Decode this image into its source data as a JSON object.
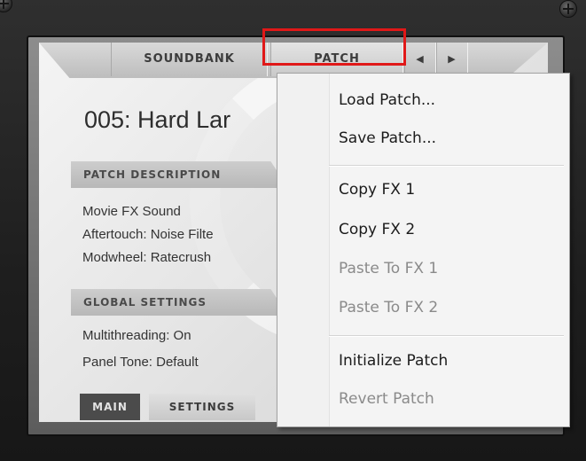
{
  "tabs": {
    "soundbank": "SOUNDBANK",
    "patch": "PATCH",
    "prev": "◀",
    "next": "▶"
  },
  "patch": {
    "name": "005: Hard Lar"
  },
  "description": {
    "header": "PATCH DESCRIPTION",
    "lines": [
      "Movie FX Sound",
      "Aftertouch: Noise Filte",
      "Modwheel: Ratecrush"
    ]
  },
  "global": {
    "header": "GLOBAL SETTINGS",
    "lines": [
      "Multithreading: On",
      "Panel Tone: Default"
    ]
  },
  "bottom_tabs": {
    "main": "MAIN",
    "settings": "SETTINGS"
  },
  "menu": {
    "items": [
      {
        "label": "Load Patch...",
        "enabled": true
      },
      {
        "label": "Save Patch...",
        "enabled": true
      },
      {
        "label": "Copy FX 1",
        "enabled": true
      },
      {
        "label": "Copy FX 2",
        "enabled": true
      },
      {
        "label": "Paste To FX 1",
        "enabled": false
      },
      {
        "label": "Paste To FX 2",
        "enabled": false
      },
      {
        "label": "Initialize Patch",
        "enabled": true
      },
      {
        "label": "Revert Patch",
        "enabled": false
      }
    ]
  },
  "colors": {
    "highlight": "#e01818"
  }
}
